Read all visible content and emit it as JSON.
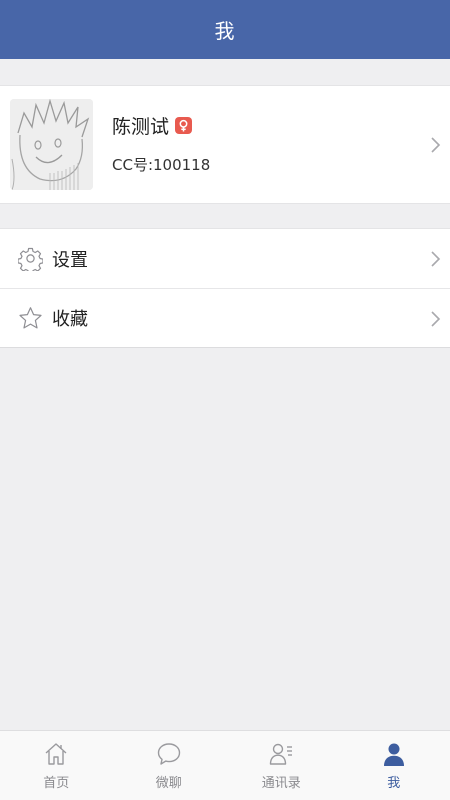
{
  "header": {
    "title": "我"
  },
  "profile": {
    "name": "陈测试",
    "cc_id": "CC号:100118",
    "gender_icon": "female-icon"
  },
  "menu": {
    "items": [
      {
        "label": "设置",
        "icon": "gear-icon"
      },
      {
        "label": "收藏",
        "icon": "star-icon"
      }
    ]
  },
  "tabbar": {
    "active": "我",
    "tabs": [
      {
        "label": "首页",
        "icon": "home-icon"
      },
      {
        "label": "微聊",
        "icon": "chat-bubble-icon"
      },
      {
        "label": "通讯录",
        "icon": "contacts-icon"
      },
      {
        "label": "我",
        "icon": "person-icon"
      }
    ]
  },
  "colors": {
    "header_bg": "#4866a8",
    "active_tab": "#3d5d9f",
    "inactive_tab": "#8a8a8e",
    "gender_badge": "#e85a4f",
    "page_bg": "#efeff1"
  }
}
